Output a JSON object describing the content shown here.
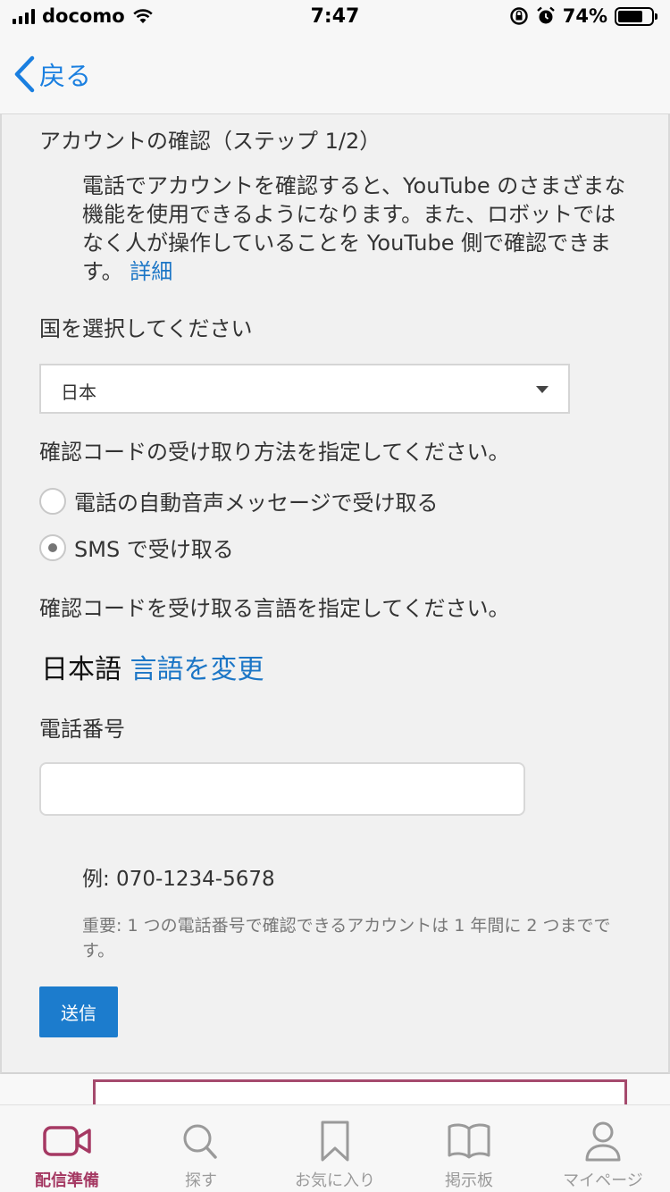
{
  "status_bar": {
    "carrier": "docomo",
    "time": "7:47",
    "battery": "74%",
    "battery_level": 0.74
  },
  "nav": {
    "back_label": "戻る"
  },
  "form": {
    "title": "アカウントの確認（ステップ 1/2）",
    "description": "電話でアカウントを確認すると、YouTube のさまざまな機能を使用できるようになります。また、ロボットではなく人が操作していることを YouTube 側で確認できます。",
    "details_link": "詳細",
    "country_label": "国を選択してください",
    "country_value": "日本",
    "method_label": "確認コードの受け取り方法を指定してください。",
    "method_options": [
      {
        "label": "電話の自動音声メッセージで受け取る",
        "selected": false
      },
      {
        "label": "SMS で受け取る",
        "selected": true
      }
    ],
    "language_label": "確認コードを受け取る言語を指定してください。",
    "language_value": "日本語",
    "change_language_link": "言語を変更",
    "phone_label": "電話番号",
    "phone_value": "",
    "example": "例: 070-1234-5678",
    "note": "重要: 1 つの電話番号で確認できるアカウントは 1 年間に 2 つまでです。",
    "submit_label": "送信"
  },
  "tab_bar": {
    "active_index": 0,
    "active_color": "#a53963",
    "tabs": [
      {
        "label": "配信準備",
        "icon": "video-camera-icon"
      },
      {
        "label": "探す",
        "icon": "search-icon"
      },
      {
        "label": "お気に入り",
        "icon": "bookmark-icon"
      },
      {
        "label": "掲示板",
        "icon": "open-book-icon"
      },
      {
        "label": "マイページ",
        "icon": "person-icon"
      }
    ]
  }
}
